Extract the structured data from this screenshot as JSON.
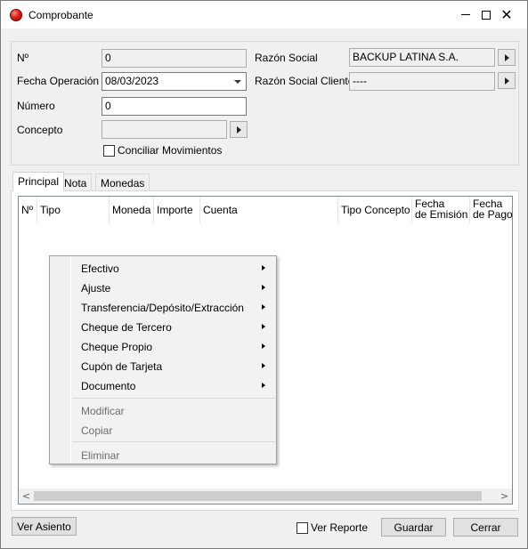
{
  "window": {
    "title": "Comprobante",
    "icon": "app-red-ball-icon"
  },
  "header": {
    "nro_label": "Nº",
    "nro_value": "0",
    "fecha_label": "Fecha Operación",
    "fecha_value": "08/03/2023",
    "numero_label": "Número",
    "numero_value": "0",
    "concepto_label": "Concepto",
    "concepto_value": "",
    "conciliar_label": "Conciliar Movimientos",
    "conciliar_checked": false,
    "razon_social_label": "Razón Social",
    "razon_social_value": "BACKUP LATINA S.A.",
    "razon_social_cliente_label": "Razón Social Cliente",
    "razon_social_cliente_value": "----"
  },
  "tabs": [
    "Principal",
    "Nota",
    "Monedas"
  ],
  "active_tab": "Principal",
  "table": {
    "columns": [
      [
        "Nº"
      ],
      [
        "Tipo"
      ],
      [
        "Moneda"
      ],
      [
        "Importe"
      ],
      [
        "Cuenta"
      ],
      [
        "Tipo Concepto"
      ],
      [
        "Fecha",
        "de Emisión"
      ],
      [
        "Fecha",
        "de Pago"
      ]
    ]
  },
  "context_menu": {
    "items": [
      {
        "label": "Efectivo",
        "submenu": true,
        "enabled": true
      },
      {
        "label": "Ajuste",
        "submenu": true,
        "enabled": true
      },
      {
        "label": "Transferencia/Depósito/Extracción",
        "submenu": true,
        "enabled": true
      },
      {
        "label": "Cheque de Tercero",
        "submenu": true,
        "enabled": true
      },
      {
        "label": "Cheque Propio",
        "submenu": true,
        "enabled": true
      },
      {
        "label": "Cupón de Tarjeta",
        "submenu": true,
        "enabled": true
      },
      {
        "label": "Documento",
        "submenu": true,
        "enabled": true
      },
      {
        "label": "Modificar",
        "submenu": false,
        "enabled": false
      },
      {
        "label": "Copiar",
        "submenu": false,
        "enabled": false
      },
      {
        "label": "Eliminar",
        "submenu": false,
        "enabled": false
      }
    ]
  },
  "footer": {
    "ver_asiento": "Ver Asiento",
    "ver_reporte": "Ver Reporte",
    "ver_reporte_checked": false,
    "guardar": "Guardar",
    "cerrar": "Cerrar"
  },
  "colors": {
    "window_bg": "#f0f0f0",
    "panel_bg": "#ffffff",
    "disabled_text": "#6d6d6d"
  }
}
